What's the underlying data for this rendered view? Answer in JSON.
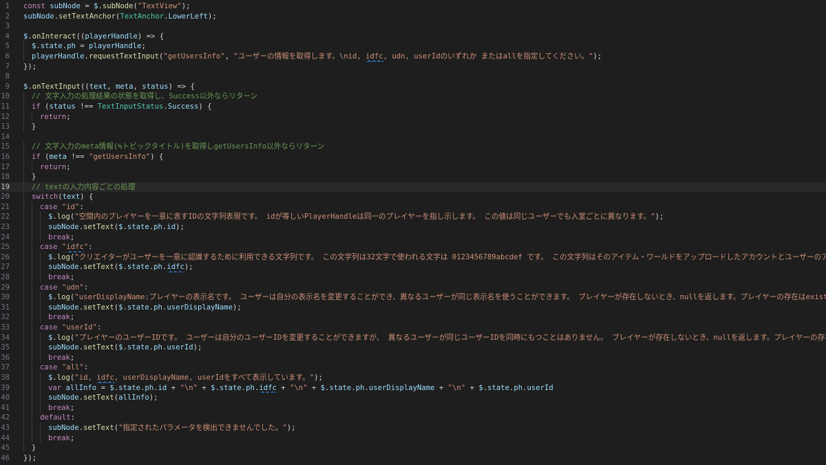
{
  "editor": {
    "current_line": 19,
    "lines": [
      [
        {
          "t": "const ",
          "c": "kw"
        },
        {
          "t": "subNode",
          "c": "vr"
        },
        {
          "t": " = ",
          "c": "pn"
        },
        {
          "t": "$",
          "c": "vr"
        },
        {
          "t": ".",
          "c": "pn"
        },
        {
          "t": "subNode",
          "c": "fn"
        },
        {
          "t": "(",
          "c": "pn"
        },
        {
          "t": "\"TextView\"",
          "c": "st"
        },
        {
          "t": ");",
          "c": "pn"
        }
      ],
      [
        {
          "t": "subNode",
          "c": "vr"
        },
        {
          "t": ".",
          "c": "pn"
        },
        {
          "t": "setTextAnchor",
          "c": "fn"
        },
        {
          "t": "(",
          "c": "pn"
        },
        {
          "t": "TextAnchor",
          "c": "ty"
        },
        {
          "t": ".",
          "c": "pn"
        },
        {
          "t": "LowerLeft",
          "c": "vr"
        },
        {
          "t": ");",
          "c": "pn"
        }
      ],
      [],
      [
        {
          "t": "$",
          "c": "vr"
        },
        {
          "t": ".",
          "c": "pn"
        },
        {
          "t": "onInteract",
          "c": "fn"
        },
        {
          "t": "((",
          "c": "pn"
        },
        {
          "t": "playerHandle",
          "c": "vr"
        },
        {
          "t": ") => {",
          "c": "pn"
        }
      ],
      [
        {
          "t": "  "
        },
        {
          "t": "$",
          "c": "vr"
        },
        {
          "t": ".",
          "c": "pn"
        },
        {
          "t": "state",
          "c": "vr"
        },
        {
          "t": ".",
          "c": "pn"
        },
        {
          "t": "ph",
          "c": "vr"
        },
        {
          "t": " = ",
          "c": "pn"
        },
        {
          "t": "playerHandle",
          "c": "vr"
        },
        {
          "t": ";",
          "c": "pn"
        }
      ],
      [
        {
          "t": "  "
        },
        {
          "t": "playerHandle",
          "c": "vr"
        },
        {
          "t": ".",
          "c": "pn"
        },
        {
          "t": "requestTextInput",
          "c": "fn"
        },
        {
          "t": "(",
          "c": "pn"
        },
        {
          "t": "\"getUsersInfo\"",
          "c": "st"
        },
        {
          "t": ", ",
          "c": "pn"
        },
        {
          "t": "\"ユーザーの情報を取得します。\\nid, ",
          "c": "st"
        },
        {
          "t": "idfc",
          "c": "st",
          "sq": true
        },
        {
          "t": ", udn, userIdのいずれか またはallを指定してください。\"",
          "c": "st"
        },
        {
          "t": ");",
          "c": "pn"
        }
      ],
      [
        {
          "t": "});",
          "c": "pn"
        }
      ],
      [],
      [
        {
          "t": "$",
          "c": "vr"
        },
        {
          "t": ".",
          "c": "pn"
        },
        {
          "t": "onTextInput",
          "c": "fn"
        },
        {
          "t": "((",
          "c": "pn"
        },
        {
          "t": "text",
          "c": "vr"
        },
        {
          "t": ", ",
          "c": "pn"
        },
        {
          "t": "meta",
          "c": "vr"
        },
        {
          "t": ", ",
          "c": "pn"
        },
        {
          "t": "status",
          "c": "vr"
        },
        {
          "t": ") => {",
          "c": "pn"
        }
      ],
      [
        {
          "t": "  "
        },
        {
          "t": "// 文字入力の処理結果の状態を取得し、Success以外ならリターン",
          "c": "cm"
        }
      ],
      [
        {
          "t": "  "
        },
        {
          "t": "if",
          "c": "kw"
        },
        {
          "t": " (",
          "c": "pn"
        },
        {
          "t": "status",
          "c": "vr"
        },
        {
          "t": " !== ",
          "c": "pn"
        },
        {
          "t": "TextInputStatus",
          "c": "ty"
        },
        {
          "t": ".",
          "c": "pn"
        },
        {
          "t": "Success",
          "c": "vr"
        },
        {
          "t": ") {",
          "c": "pn"
        }
      ],
      [
        {
          "t": "    "
        },
        {
          "t": "return",
          "c": "kw"
        },
        {
          "t": ";",
          "c": "pn"
        }
      ],
      [
        {
          "t": "  "
        },
        {
          "t": "}",
          "c": "pn"
        }
      ],
      [],
      [
        {
          "t": "  "
        },
        {
          "t": "// 文字入力のmeta情報(≒トピックタイトル)を取得しgetUsersInfo以外ならリターン",
          "c": "cm"
        }
      ],
      [
        {
          "t": "  "
        },
        {
          "t": "if",
          "c": "kw"
        },
        {
          "t": " (",
          "c": "pn"
        },
        {
          "t": "meta",
          "c": "vr"
        },
        {
          "t": " !== ",
          "c": "pn"
        },
        {
          "t": "\"getUsersInfo\"",
          "c": "st"
        },
        {
          "t": ") {",
          "c": "pn"
        }
      ],
      [
        {
          "t": "    "
        },
        {
          "t": "return",
          "c": "kw"
        },
        {
          "t": ";",
          "c": "pn"
        }
      ],
      [
        {
          "t": "  "
        },
        {
          "t": "}",
          "c": "pn"
        }
      ],
      [
        {
          "t": "  "
        },
        {
          "t": "// textの入力内容ごとの処理",
          "c": "cm"
        }
      ],
      [
        {
          "t": "  "
        },
        {
          "t": "switch",
          "c": "kw"
        },
        {
          "t": "(",
          "c": "pn"
        },
        {
          "t": "text",
          "c": "vr"
        },
        {
          "t": ") {",
          "c": "pn"
        }
      ],
      [
        {
          "t": "    "
        },
        {
          "t": "case",
          "c": "kw"
        },
        {
          "t": " "
        },
        {
          "t": "\"id\"",
          "c": "st"
        },
        {
          "t": ":",
          "c": "pn"
        }
      ],
      [
        {
          "t": "      "
        },
        {
          "t": "$",
          "c": "vr"
        },
        {
          "t": ".",
          "c": "pn"
        },
        {
          "t": "log",
          "c": "fn"
        },
        {
          "t": "(",
          "c": "pn"
        },
        {
          "t": "\"空間内のプレイヤーを一意に表すIDの文字列表現です。 idが等しいPlayerHandleは同一のプレイヤーを指し示します。 この値は同じユーザーでも入室ごとに異なります。\"",
          "c": "st"
        },
        {
          "t": ");",
          "c": "pn"
        }
      ],
      [
        {
          "t": "      "
        },
        {
          "t": "subNode",
          "c": "vr"
        },
        {
          "t": ".",
          "c": "pn"
        },
        {
          "t": "setText",
          "c": "fn"
        },
        {
          "t": "(",
          "c": "pn"
        },
        {
          "t": "$",
          "c": "vr"
        },
        {
          "t": ".",
          "c": "pn"
        },
        {
          "t": "state",
          "c": "vr"
        },
        {
          "t": ".",
          "c": "pn"
        },
        {
          "t": "ph",
          "c": "vr"
        },
        {
          "t": ".",
          "c": "pn"
        },
        {
          "t": "id",
          "c": "vr"
        },
        {
          "t": ");",
          "c": "pn"
        }
      ],
      [
        {
          "t": "      "
        },
        {
          "t": "break",
          "c": "kw"
        },
        {
          "t": ";",
          "c": "pn"
        }
      ],
      [
        {
          "t": "    "
        },
        {
          "t": "case",
          "c": "kw"
        },
        {
          "t": " "
        },
        {
          "t": "\"",
          "c": "st"
        },
        {
          "t": "idfc",
          "c": "st",
          "sq": true
        },
        {
          "t": "\"",
          "c": "st"
        },
        {
          "t": ":",
          "c": "pn"
        }
      ],
      [
        {
          "t": "      "
        },
        {
          "t": "$",
          "c": "vr"
        },
        {
          "t": ".",
          "c": "pn"
        },
        {
          "t": "log",
          "c": "fn"
        },
        {
          "t": "(",
          "c": "pn"
        },
        {
          "t": "\"クリエイターがユーザーを一意に認識するために利用できる文字列です。 この文字列は32文字で使われる文字は 0123456789abcdef です。 この文字列はそのアイテム・ワールドをアップロードしたアカウントとユーザーのアカウントとの組によ",
          "c": "st"
        }
      ],
      [
        {
          "t": "      "
        },
        {
          "t": "subNode",
          "c": "vr"
        },
        {
          "t": ".",
          "c": "pn"
        },
        {
          "t": "setText",
          "c": "fn"
        },
        {
          "t": "(",
          "c": "pn"
        },
        {
          "t": "$",
          "c": "vr"
        },
        {
          "t": ".",
          "c": "pn"
        },
        {
          "t": "state",
          "c": "vr"
        },
        {
          "t": ".",
          "c": "pn"
        },
        {
          "t": "ph",
          "c": "vr"
        },
        {
          "t": ".",
          "c": "pn"
        },
        {
          "t": "idfc",
          "c": "vr",
          "sq": true
        },
        {
          "t": ");",
          "c": "pn"
        }
      ],
      [
        {
          "t": "      "
        },
        {
          "t": "break",
          "c": "kw"
        },
        {
          "t": ";",
          "c": "pn"
        }
      ],
      [
        {
          "t": "    "
        },
        {
          "t": "case",
          "c": "kw"
        },
        {
          "t": " "
        },
        {
          "t": "\"udn\"",
          "c": "st"
        },
        {
          "t": ":",
          "c": "pn"
        }
      ],
      [
        {
          "t": "      "
        },
        {
          "t": "$",
          "c": "vr"
        },
        {
          "t": ".",
          "c": "pn"
        },
        {
          "t": "log",
          "c": "fn"
        },
        {
          "t": "(",
          "c": "pn"
        },
        {
          "t": "\"userDisplayName:プレイヤーの表示名です。 ユーザーは自分の表示名を変更することができ、異なるユーザーが同じ表示名を使うことができます。 プレイヤーが存在しないとき、nullを返します。プレイヤーの存在はexistsで確認できます。\"",
          "c": "st"
        }
      ],
      [
        {
          "t": "      "
        },
        {
          "t": "subNode",
          "c": "vr"
        },
        {
          "t": ".",
          "c": "pn"
        },
        {
          "t": "setText",
          "c": "fn"
        },
        {
          "t": "(",
          "c": "pn"
        },
        {
          "t": "$",
          "c": "vr"
        },
        {
          "t": ".",
          "c": "pn"
        },
        {
          "t": "state",
          "c": "vr"
        },
        {
          "t": ".",
          "c": "pn"
        },
        {
          "t": "ph",
          "c": "vr"
        },
        {
          "t": ".",
          "c": "pn"
        },
        {
          "t": "userDisplayName",
          "c": "vr"
        },
        {
          "t": ");",
          "c": "pn"
        }
      ],
      [
        {
          "t": "      "
        },
        {
          "t": "break",
          "c": "kw"
        },
        {
          "t": ";",
          "c": "pn"
        }
      ],
      [
        {
          "t": "    "
        },
        {
          "t": "case",
          "c": "kw"
        },
        {
          "t": " "
        },
        {
          "t": "\"userId\"",
          "c": "st"
        },
        {
          "t": ":",
          "c": "pn"
        }
      ],
      [
        {
          "t": "      "
        },
        {
          "t": "$",
          "c": "vr"
        },
        {
          "t": ".",
          "c": "pn"
        },
        {
          "t": "log",
          "c": "fn"
        },
        {
          "t": "(",
          "c": "pn"
        },
        {
          "t": "\"プレイヤーのユーザーIDです。 ユーザーは自分のユーザーIDを変更することができますが、 異なるユーザーが同じユーザーIDを同時にもつことはありません。 プレイヤーが存在しないとき、nullを返します。プレイヤーの存在はexistsで確認で",
          "c": "st"
        }
      ],
      [
        {
          "t": "      "
        },
        {
          "t": "subNode",
          "c": "vr"
        },
        {
          "t": ".",
          "c": "pn"
        },
        {
          "t": "setText",
          "c": "fn"
        },
        {
          "t": "(",
          "c": "pn"
        },
        {
          "t": "$",
          "c": "vr"
        },
        {
          "t": ".",
          "c": "pn"
        },
        {
          "t": "state",
          "c": "vr"
        },
        {
          "t": ".",
          "c": "pn"
        },
        {
          "t": "ph",
          "c": "vr"
        },
        {
          "t": ".",
          "c": "pn"
        },
        {
          "t": "userId",
          "c": "vr"
        },
        {
          "t": ");",
          "c": "pn"
        }
      ],
      [
        {
          "t": "      "
        },
        {
          "t": "break",
          "c": "kw"
        },
        {
          "t": ";",
          "c": "pn"
        }
      ],
      [
        {
          "t": "    "
        },
        {
          "t": "case",
          "c": "kw"
        },
        {
          "t": " "
        },
        {
          "t": "\"all\"",
          "c": "st"
        },
        {
          "t": ":",
          "c": "pn"
        }
      ],
      [
        {
          "t": "      "
        },
        {
          "t": "$",
          "c": "vr"
        },
        {
          "t": ".",
          "c": "pn"
        },
        {
          "t": "log",
          "c": "fn"
        },
        {
          "t": "(",
          "c": "pn"
        },
        {
          "t": "\"id, ",
          "c": "st"
        },
        {
          "t": "idfc",
          "c": "st",
          "sq": true
        },
        {
          "t": ", userDisplayName, userIdをすべて表示しています。\"",
          "c": "st"
        },
        {
          "t": ");",
          "c": "pn"
        }
      ],
      [
        {
          "t": "      "
        },
        {
          "t": "var",
          "c": "kw"
        },
        {
          "t": " "
        },
        {
          "t": "allInfo",
          "c": "vr"
        },
        {
          "t": " = ",
          "c": "pn"
        },
        {
          "t": "$",
          "c": "vr"
        },
        {
          "t": ".",
          "c": "pn"
        },
        {
          "t": "state",
          "c": "vr"
        },
        {
          "t": ".",
          "c": "pn"
        },
        {
          "t": "ph",
          "c": "vr"
        },
        {
          "t": ".",
          "c": "pn"
        },
        {
          "t": "id",
          "c": "vr"
        },
        {
          "t": " + ",
          "c": "pn"
        },
        {
          "t": "\"\\n\"",
          "c": "st"
        },
        {
          "t": " + ",
          "c": "pn"
        },
        {
          "t": "$",
          "c": "vr"
        },
        {
          "t": ".",
          "c": "pn"
        },
        {
          "t": "state",
          "c": "vr"
        },
        {
          "t": ".",
          "c": "pn"
        },
        {
          "t": "ph",
          "c": "vr"
        },
        {
          "t": ".",
          "c": "pn"
        },
        {
          "t": "idfc",
          "c": "vr",
          "sq": true
        },
        {
          "t": " + ",
          "c": "pn"
        },
        {
          "t": "\"\\n\"",
          "c": "st"
        },
        {
          "t": " + ",
          "c": "pn"
        },
        {
          "t": "$",
          "c": "vr"
        },
        {
          "t": ".",
          "c": "pn"
        },
        {
          "t": "state",
          "c": "vr"
        },
        {
          "t": ".",
          "c": "pn"
        },
        {
          "t": "ph",
          "c": "vr"
        },
        {
          "t": ".",
          "c": "pn"
        },
        {
          "t": "userDisplayName",
          "c": "vr"
        },
        {
          "t": " + ",
          "c": "pn"
        },
        {
          "t": "\"\\n\"",
          "c": "st"
        },
        {
          "t": " + ",
          "c": "pn"
        },
        {
          "t": "$",
          "c": "vr"
        },
        {
          "t": ".",
          "c": "pn"
        },
        {
          "t": "state",
          "c": "vr"
        },
        {
          "t": ".",
          "c": "pn"
        },
        {
          "t": "ph",
          "c": "vr"
        },
        {
          "t": ".",
          "c": "pn"
        },
        {
          "t": "userId",
          "c": "vr"
        }
      ],
      [
        {
          "t": "      "
        },
        {
          "t": "subNode",
          "c": "vr"
        },
        {
          "t": ".",
          "c": "pn"
        },
        {
          "t": "setText",
          "c": "fn"
        },
        {
          "t": "(",
          "c": "pn"
        },
        {
          "t": "allInfo",
          "c": "vr"
        },
        {
          "t": ");",
          "c": "pn"
        }
      ],
      [
        {
          "t": "      "
        },
        {
          "t": "break",
          "c": "kw"
        },
        {
          "t": ";",
          "c": "pn"
        }
      ],
      [
        {
          "t": "    "
        },
        {
          "t": "default",
          "c": "kw"
        },
        {
          "t": ":",
          "c": "pn"
        }
      ],
      [
        {
          "t": "      "
        },
        {
          "t": "subNode",
          "c": "vr"
        },
        {
          "t": ".",
          "c": "pn"
        },
        {
          "t": "setText",
          "c": "fn"
        },
        {
          "t": "(",
          "c": "pn"
        },
        {
          "t": "\"指定されたパラメータを検出できませんでした。\"",
          "c": "st"
        },
        {
          "t": ");",
          "c": "pn"
        }
      ],
      [
        {
          "t": "      "
        },
        {
          "t": "break",
          "c": "kw"
        },
        {
          "t": ";",
          "c": "pn"
        }
      ],
      [
        {
          "t": "  "
        },
        {
          "t": "}",
          "c": "pn"
        }
      ],
      [
        {
          "t": "});",
          "c": "pn"
        }
      ]
    ]
  }
}
